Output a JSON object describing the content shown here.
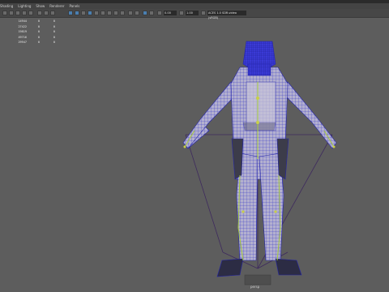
{
  "menus": [
    "Shading",
    "Lighting",
    "Show",
    "Renderer",
    "Panels"
  ],
  "toolbar": {
    "value_a": "0.00",
    "value_b": "1.00",
    "color_space": "ACES 1.0 SDR-video (sRGB)"
  },
  "hud_rows": [
    {
      "v1": "14944",
      "v2": "0",
      "v3": "0"
    },
    {
      "v1": "27422",
      "v2": "0",
      "v3": "0"
    },
    {
      "v1": "19819",
      "v2": "0",
      "v3": "0"
    },
    {
      "v1": "49716",
      "v2": "0",
      "v3": "0"
    },
    {
      "v1": "29947",
      "v2": "0",
      "v3": "0"
    }
  ],
  "colors": {
    "viewport_bg": "#5d5d5d",
    "wireframe": "#2b2bd0",
    "mesh_fill": "#a9a6c6",
    "joint_color": "#b0c640",
    "ik_line": "#4a2a6a"
  },
  "icons": [
    "select-tool-icon",
    "move-tool-icon",
    "rotate-tool-icon",
    "scale-tool-icon",
    "camera-icon",
    "grid-toggle-icon",
    "wireframe-toggle-icon",
    "shaded-toggle-icon",
    "textured-toggle-icon",
    "lights-icon",
    "shadows-icon",
    "xray-icon",
    "isolate-icon",
    "resolution-gate-icon"
  ],
  "view_label": "persp"
}
